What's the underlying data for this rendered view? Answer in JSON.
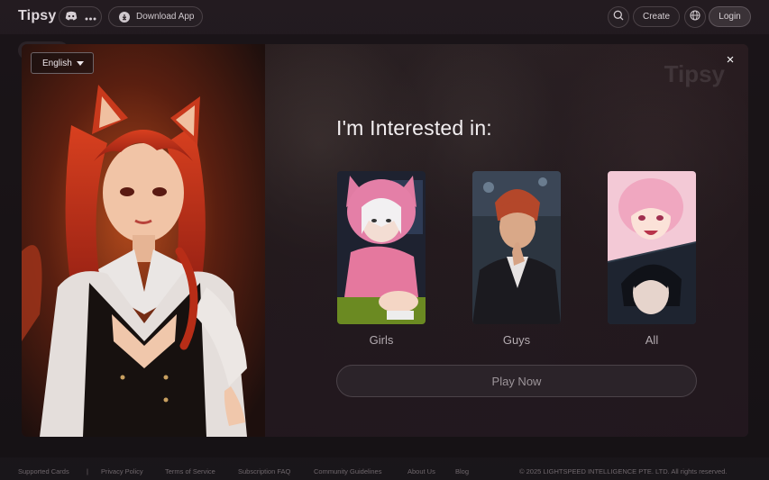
{
  "header": {
    "logo": "Tipsy",
    "download_label": "Download App",
    "create_label": "Create",
    "login_label": "Login"
  },
  "modal": {
    "language": "English",
    "watermark": "Tipsy",
    "close_label": "×",
    "heading": "I'm Interested in:",
    "choices": [
      {
        "label": "Girls"
      },
      {
        "label": "Guys"
      },
      {
        "label": "All"
      }
    ],
    "play_label": "Play Now"
  },
  "footer": {
    "links": [
      "Supported Cards",
      "|",
      "Privacy Policy",
      "Terms of Service",
      "Subscription FAQ",
      "Community Guidelines",
      "About Us",
      "Blog"
    ],
    "copyright": "© 2025 LIGHTSPEED INTELLIGENCE PTE. LTD. All rights reserved."
  },
  "colors": {
    "background": "#1b1518",
    "accent_hair": "#c2341c",
    "text": "#e8e2e6"
  },
  "icons": [
    "discord-icon",
    "more-icon",
    "download-icon",
    "search-icon",
    "globe-icon",
    "close-icon",
    "caret-down-icon"
  ]
}
